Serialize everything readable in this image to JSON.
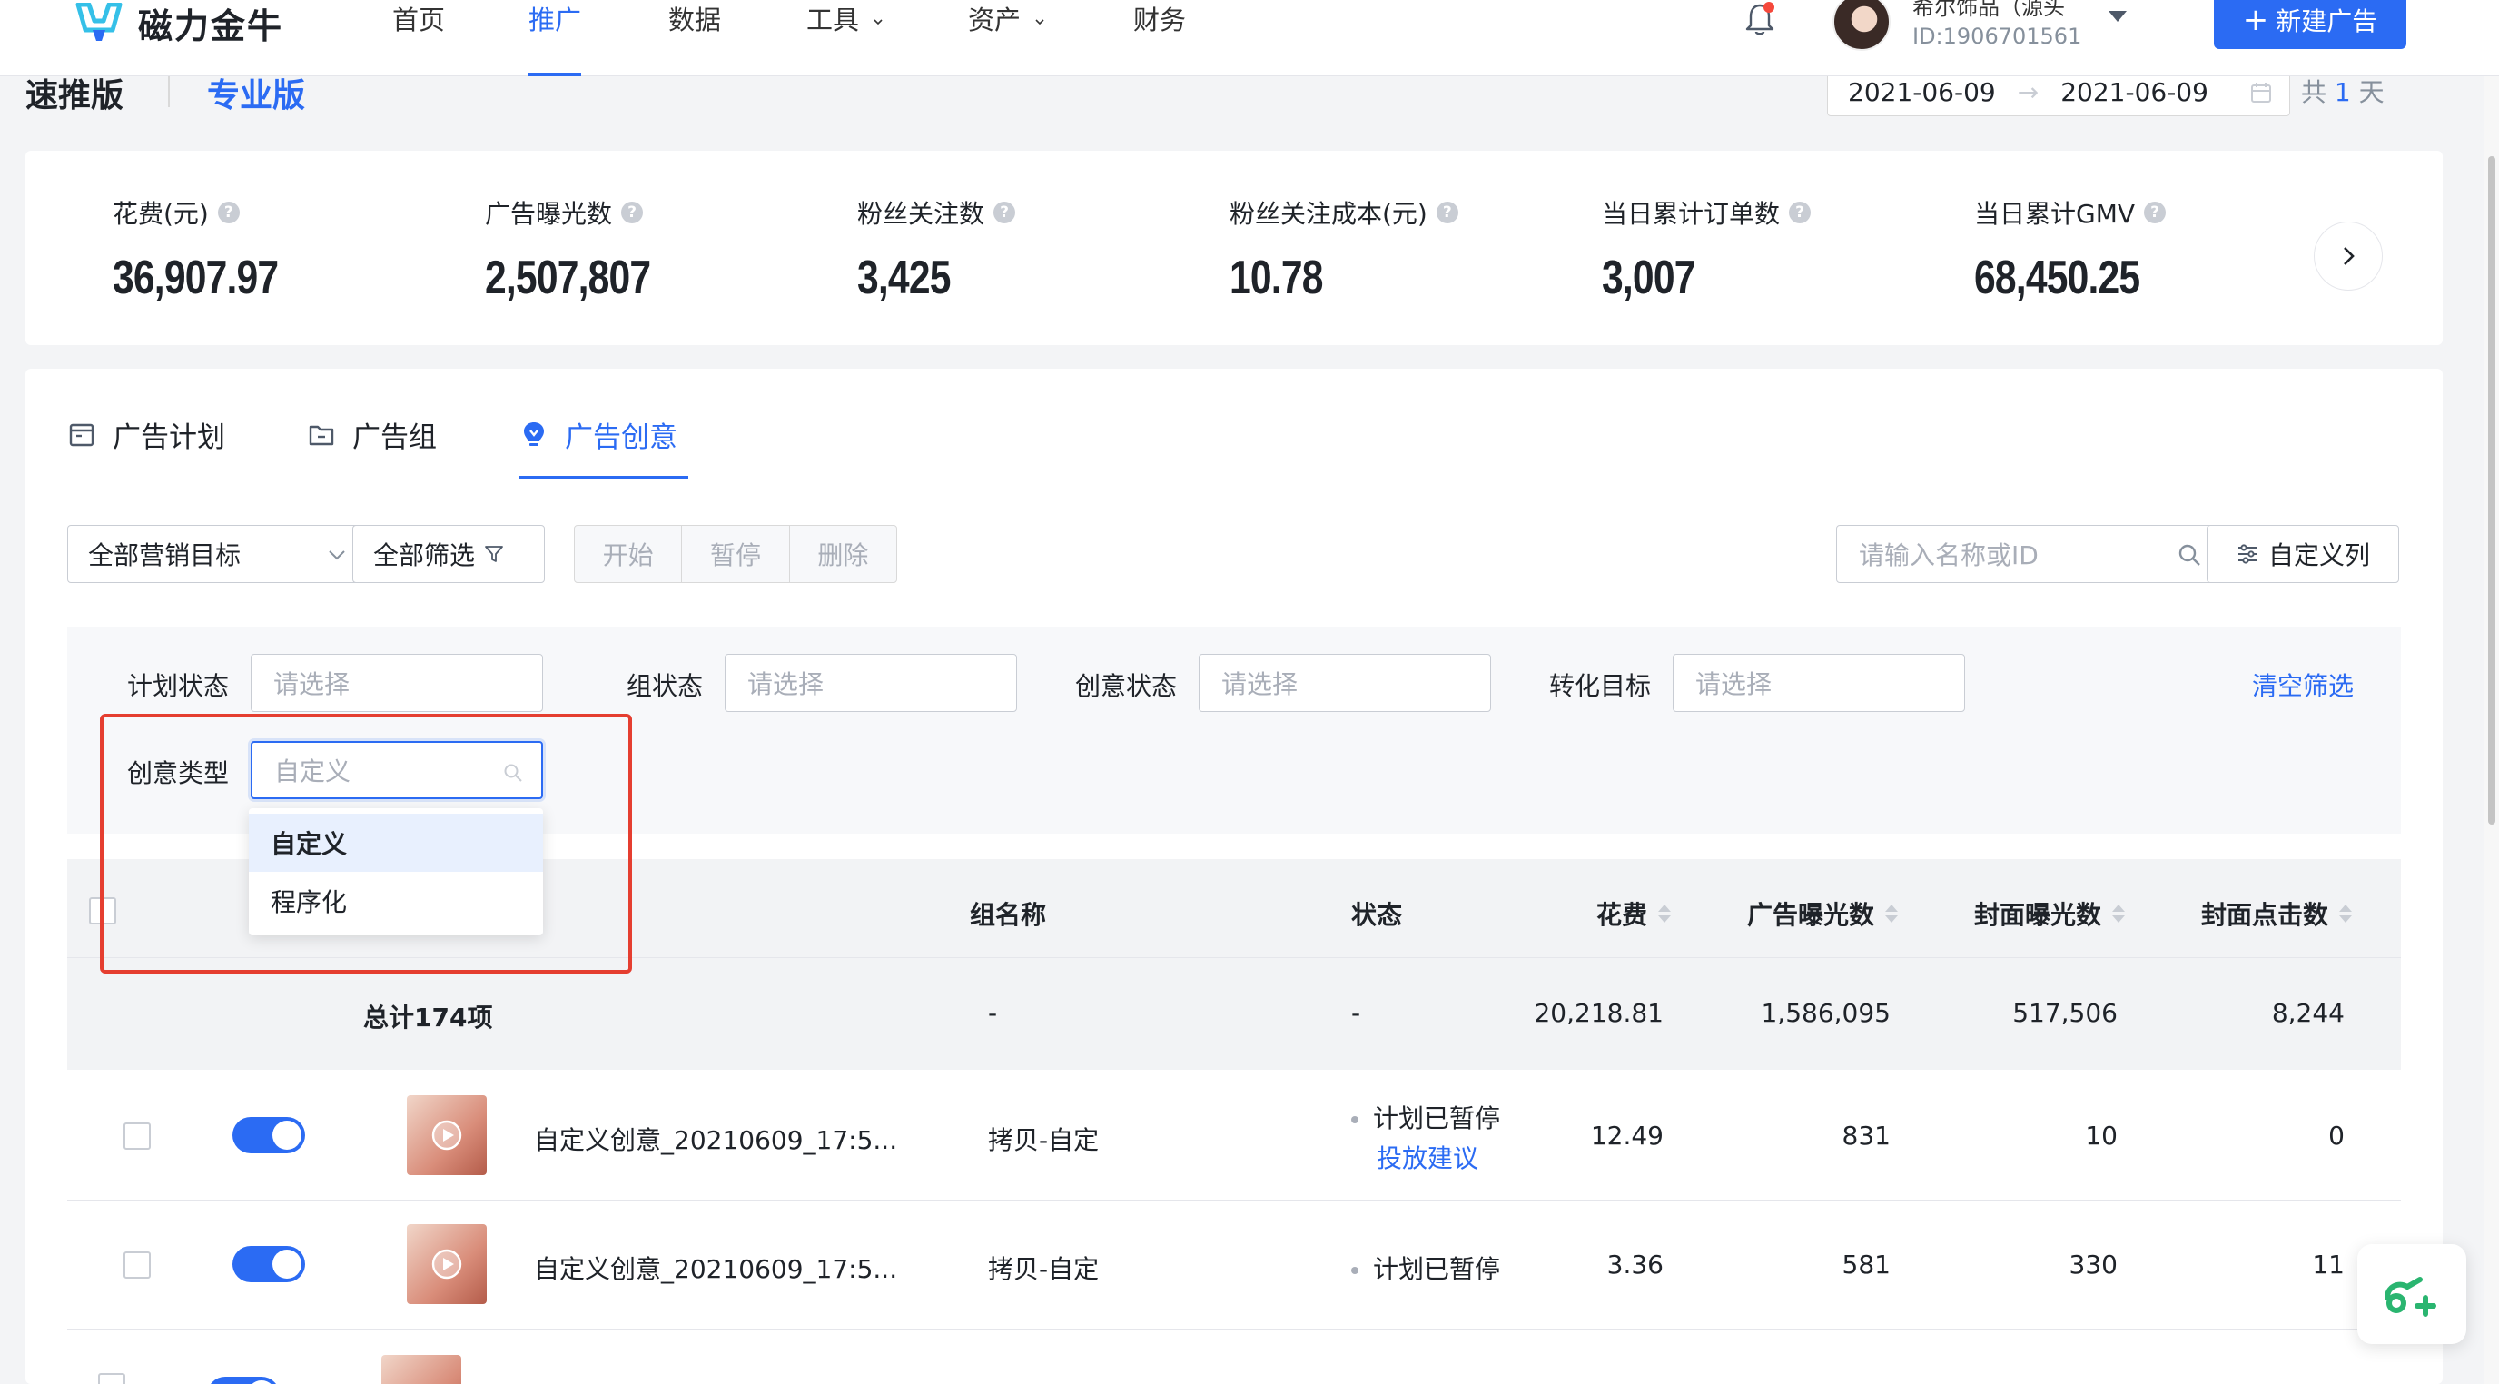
{
  "brand": {
    "name": "磁力金牛"
  },
  "nav": {
    "items": [
      {
        "label": "首页"
      },
      {
        "label": "推广"
      },
      {
        "label": "数据"
      },
      {
        "label": "工具"
      },
      {
        "label": "资产"
      },
      {
        "label": "财务"
      }
    ],
    "active": "推广"
  },
  "account": {
    "name": "希尔饰品（源头",
    "id": "ID:1906701561"
  },
  "new_ad_label": "新建广告",
  "mode": {
    "left": "速推版",
    "right": "专业版"
  },
  "date_range": {
    "start": "2021-06-09",
    "arrow": "→",
    "end": "2021-06-09",
    "days_prefix": "共",
    "days": "1",
    "days_suffix": "天"
  },
  "metrics": [
    {
      "label": "花费(元)",
      "value": "36,907.97"
    },
    {
      "label": "广告曝光数",
      "value": "2,507,807"
    },
    {
      "label": "粉丝关注数",
      "value": "3,425"
    },
    {
      "label": "粉丝关注成本(元)",
      "value": "10.78"
    },
    {
      "label": "当日累计订单数",
      "value": "3,007"
    },
    {
      "label": "当日累计GMV",
      "value": "68,450.25"
    }
  ],
  "tabs": [
    {
      "label": "广告计划"
    },
    {
      "label": "广告组"
    },
    {
      "label": "广告创意"
    }
  ],
  "toolbar": {
    "goal_select": "全部营销目标",
    "all_filter": "全部筛选",
    "start": "开始",
    "pause": "暂停",
    "delete": "删除",
    "search_placeholder": "请输入名称或ID",
    "custom_columns": "自定义列"
  },
  "filters": {
    "plan_status_label": "计划状态",
    "group_status_label": "组状态",
    "creative_status_label": "创意状态",
    "conversion_label": "转化目标",
    "creative_type_label": "创意类型",
    "placeholder": "请选择",
    "creative_type_value": "自定义",
    "clear": "清空筛选",
    "dropdown_options": [
      "自定义",
      "程序化"
    ]
  },
  "table": {
    "headers": {
      "group_name": "组名称",
      "status": "状态",
      "cost": "花费",
      "impressions": "广告曝光数",
      "cover_impressions": "封面曝光数",
      "cover_clicks": "封面点击数"
    },
    "total": {
      "label": "总计174项",
      "group_name": "-",
      "status": "-",
      "cost": "20,218.81",
      "impressions": "1,586,095",
      "cover_impressions": "517,506",
      "cover_clicks": "8,244"
    },
    "rows": [
      {
        "name": "自定义创意_20210609_17:5...",
        "group_name": "拷贝-自定",
        "status": "计划已暂停",
        "advice": "投放建议",
        "cost": "12.49",
        "impressions": "831",
        "cover_impressions": "10",
        "cover_clicks": "0"
      },
      {
        "name": "自定义创意_20210609_17:5...",
        "group_name": "拷贝-自定",
        "status": "计划已暂停",
        "cost": "3.36",
        "impressions": "581",
        "cover_impressions": "330",
        "cover_clicks": "11"
      }
    ]
  },
  "colors": {
    "accent": "#2b6bf3",
    "highlight_box": "#e53e30"
  }
}
